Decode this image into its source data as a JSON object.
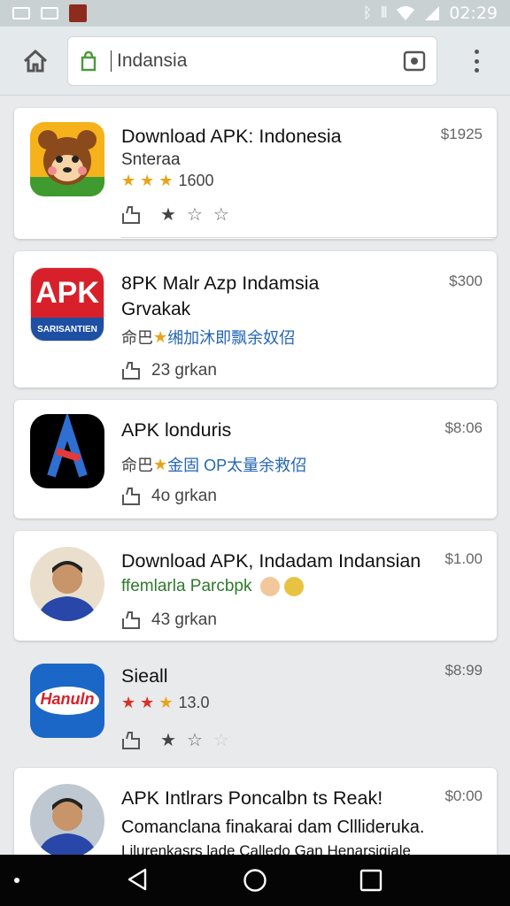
{
  "status_bar": {
    "time": "02:29",
    "icons": [
      "image-icon",
      "photo-icon",
      "app-icon",
      "bluetooth-icon",
      "vibrate-icon",
      "wifi-icon",
      "signal-icon"
    ]
  },
  "toolbar": {
    "url_text": "Indansia",
    "icons": [
      "home-icon",
      "page-icon",
      "camera-icon",
      "more-vert-icon"
    ]
  },
  "results": [
    {
      "title": "Download APK: Indonesia",
      "subtitle": "Snteraa",
      "rating_stars": 3,
      "rating_count": "1600",
      "price": "$1925",
      "action_stars_filled": 1,
      "action_stars_total": 3,
      "icon": "bear-face-icon"
    },
    {
      "title": "8PK Malr Azp Indamsia",
      "subtitle": "Grvakak",
      "meta_prefix": "命巴",
      "meta_text": "缃加沐即飘余奴佋",
      "price": "$300",
      "action_text": "23  grkan",
      "icon_label": "APK",
      "icon_sublabel": "SARISANTIEN",
      "icon": "apk-logo-icon"
    },
    {
      "title": "APK londuris",
      "meta_prefix": "命巴",
      "meta_text": "金固 OP太量余救佋",
      "price": "$8:06",
      "action_text": "4o  grkan",
      "icon": "a-logo-icon"
    },
    {
      "title": "Download APK, Indadam Indansian",
      "subtitle": "ffemlarla Parcbpk",
      "price": "$1.00",
      "action_text": "43  grkan",
      "icon": "person-avatar-icon"
    },
    {
      "title": "Sieall",
      "rating_stars": 3,
      "rating_count": "13.0",
      "price": "$8:99",
      "action_stars_filled": 1,
      "action_stars_total": 3,
      "icon_label": "Hanuln",
      "icon": "soda-logo-icon"
    },
    {
      "title": "APK Intlrars Poncalbn ts Reak!",
      "subtitle": "Comanclana finakarai dam Clllideruka.",
      "subtitle2": "Lilurenkasrs lade Calledo Gan Henarsigiale",
      "price": "$0:00",
      "icon": "person-avatar-icon"
    }
  ],
  "nav_bar": {
    "icons": [
      "dot-icon",
      "back-icon",
      "home-circle-icon",
      "recents-icon"
    ]
  },
  "colors": {
    "status_bar": "#c9d1d3",
    "toolbar": "#e4eaec",
    "background": "#e9eaeb",
    "star_gold": "#e8a317",
    "star_red": "#d93025",
    "link_blue": "#2466b5",
    "green_text": "#2f7a2c",
    "nav_bar": "#050505"
  }
}
